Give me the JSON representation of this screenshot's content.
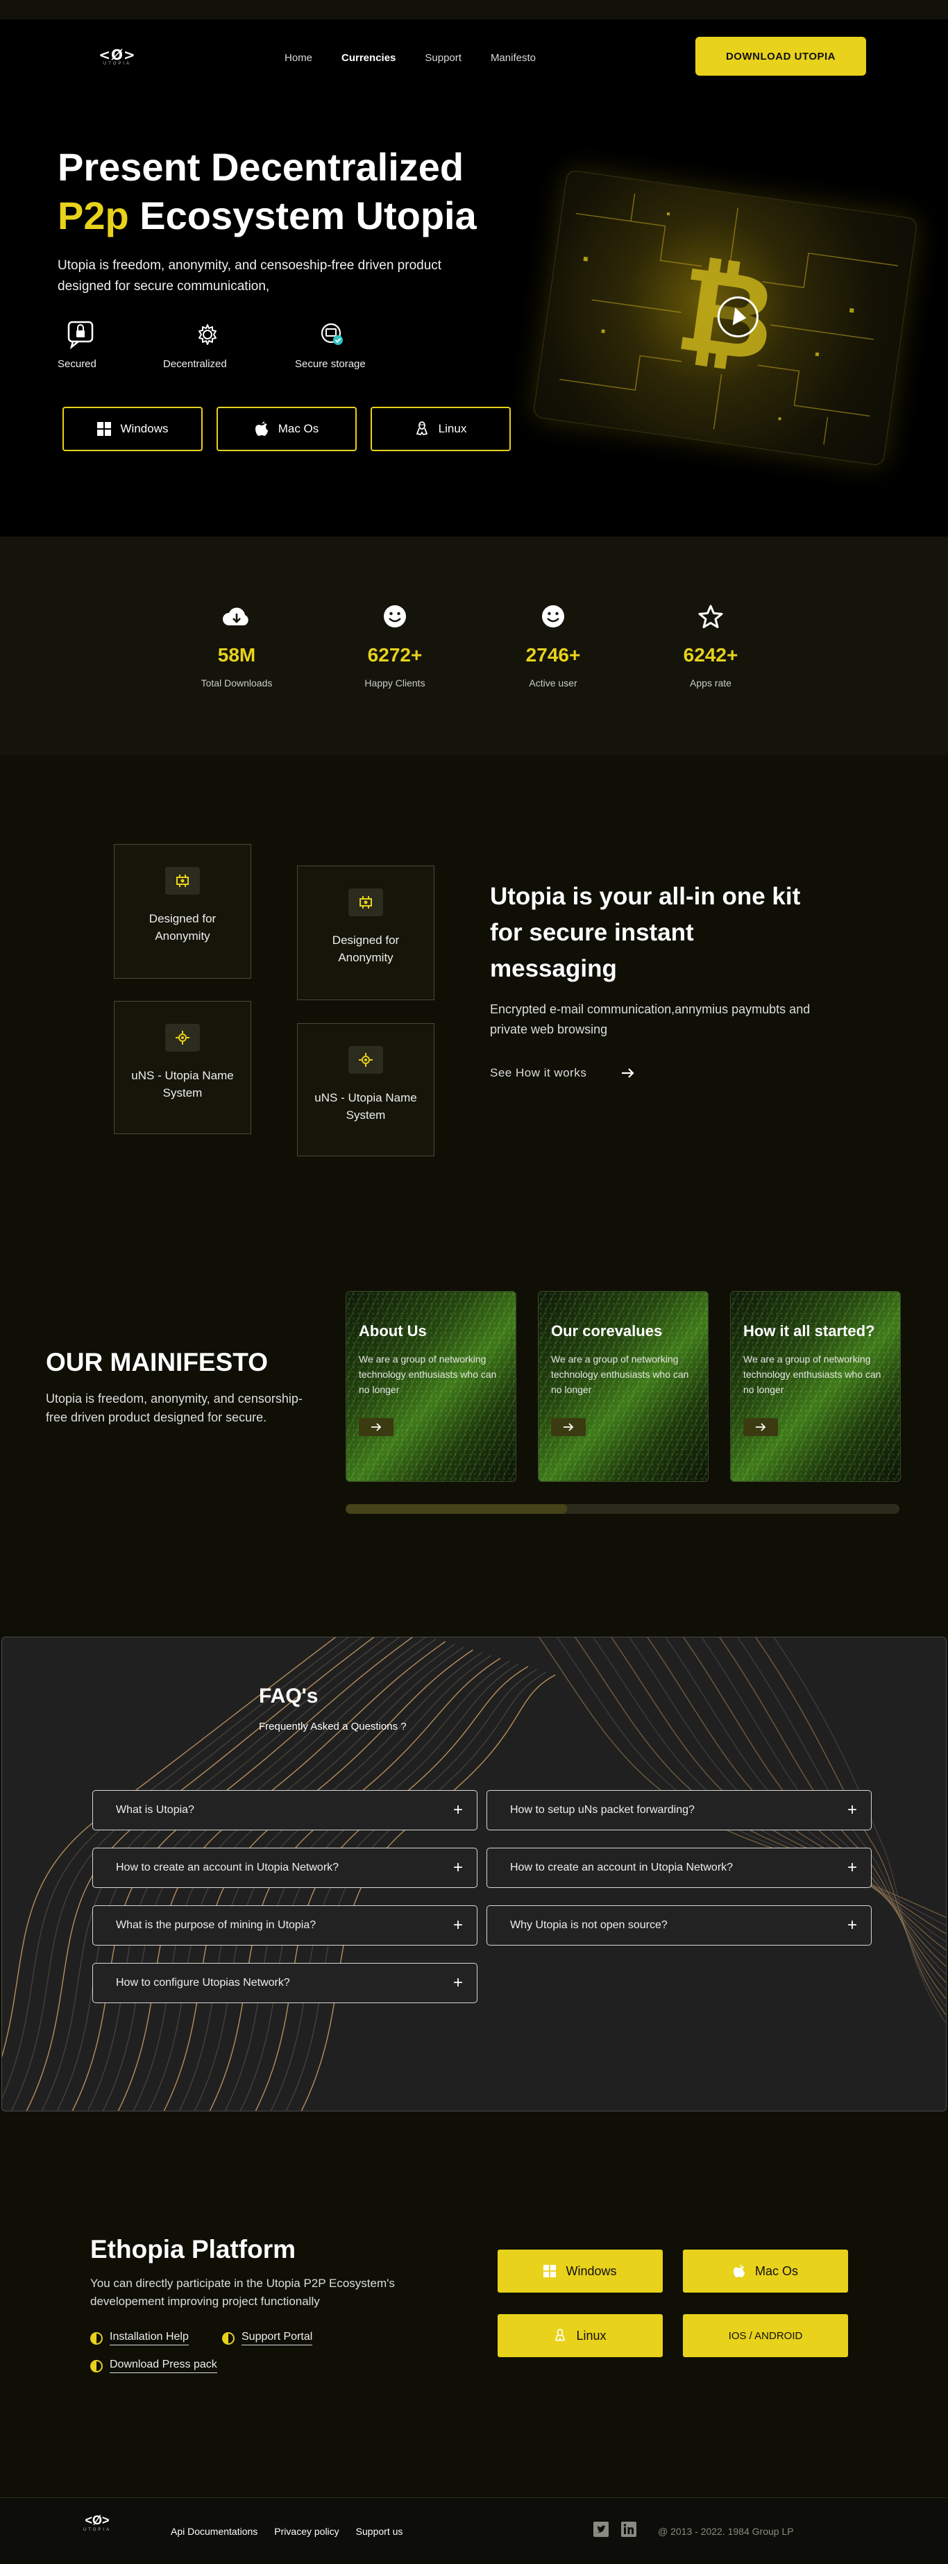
{
  "nav": {
    "logo_mark": "<Ø>",
    "logo_sub": "UTOPIA",
    "links": [
      "Home",
      "Currencies",
      "Support",
      "Manifesto"
    ],
    "download_label": "DOWNLOAD UTOPIA"
  },
  "hero": {
    "title_line1": "Present Decentralized",
    "title_accent": "P2p",
    "title_line2_rest": " Ecosystem Utopia",
    "description": "Utopia is freedom, anonymity, and censoeship-free driven product designed for secure communication,",
    "features": [
      "Secured",
      "Decentralized",
      "Secure storage"
    ],
    "os_buttons": [
      "Windows",
      "Mac Os",
      "Linux"
    ],
    "art_icon": "bitcoin-icon"
  },
  "stats": [
    {
      "icon": "cloud-download-icon",
      "value": "58M",
      "label": "Total Downloads"
    },
    {
      "icon": "smiley-icon",
      "value": "6272+",
      "label": "Happy Clients"
    },
    {
      "icon": "smiley-icon",
      "value": "2746+",
      "label": "Active user"
    },
    {
      "icon": "star-icon",
      "value": "6242+",
      "label": "Apps rate"
    }
  ],
  "kit": {
    "cards": [
      "Designed for Anonymity",
      "Designed for Anonymity",
      "uNS - Utopia Name System",
      "uNS - Utopia Name System"
    ],
    "title": "Utopia is your all-in one kit for secure instant messaging",
    "description": "Encrypted e-mail communication,annymius paymubts and private web browsing",
    "link": "See How it works"
  },
  "manifesto": {
    "title": "OUR MAINIFESTO",
    "description": "Utopia is freedom, anonymity, and censorship-free driven product designed for secure.",
    "cards": [
      {
        "title": "About Us",
        "text": "We are a group of networking technology enthusiasts who can no longer"
      },
      {
        "title": "Our corevalues",
        "text": "We are a group of networking technology enthusiasts who can no longer"
      },
      {
        "title": "How it all started?",
        "text": "We are a group of networking technology enthusiasts who can no longer"
      }
    ],
    "scroll_progress": 0.4
  },
  "faq": {
    "title": "FAQ's",
    "subtitle": "Frequently Asked a Questions ?",
    "items": [
      "What is Utopia?",
      "How to setup uNs packet forwarding?",
      "How to create an account in Utopia Network?",
      "How to create an account in Utopia Network?",
      "What is the purpose of mining in Utopia?",
      "Why Utopia is not open source?",
      "How to configure Utopias Network?"
    ]
  },
  "platform": {
    "title": "Ethopia Platform",
    "description": "You can directly participate in the Utopia P2P Ecosystem's developement improving project functionally",
    "links": [
      "Installation Help",
      "Support Portal",
      "Download Press pack"
    ],
    "buttons": [
      "Windows",
      "Mac Os",
      "Linux",
      "IOS / ANDROID"
    ]
  },
  "footer": {
    "links": [
      "Api Documentations",
      "Privacey policy",
      "Support us"
    ],
    "copyright": "@ 2013 - 2022. 1984 Group LP"
  },
  "colors": {
    "accent": "#e8d21b",
    "bg_dark": "#000000",
    "bg_olive": "#14140a"
  }
}
